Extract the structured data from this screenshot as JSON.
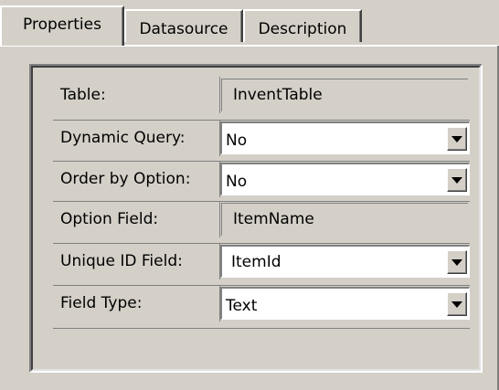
{
  "tabs": [
    {
      "label": "Properties",
      "active": true
    },
    {
      "label": "Datasource",
      "active": false
    },
    {
      "label": "Description",
      "active": false
    }
  ],
  "properties": {
    "table_label": "Table:",
    "table_value": "InventTable",
    "dynamic_query_label": "Dynamic Query:",
    "dynamic_query_value": "No",
    "order_by_label": "Order by Option:",
    "order_by_value": "No",
    "option_field_label": "Option Field:",
    "option_field_value": "ItemName",
    "unique_id_label": "Unique ID Field:",
    "unique_id_value": "ItemId",
    "field_type_label": "Field Type:",
    "field_type_value": "Text"
  },
  "icons": {
    "dropdown": "chevron-down-icon"
  },
  "colors": {
    "face": "#d4d0c8",
    "field": "#ffffff",
    "shadow": "#808080",
    "highlight": "#ffffff"
  }
}
